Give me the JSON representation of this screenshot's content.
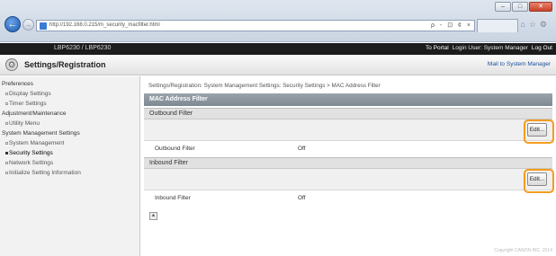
{
  "browser": {
    "url": "http://192.168.0.215/m_security_macfilter.html",
    "tools": "ρ - ⊡ ¢ ×"
  },
  "header": {
    "model": "LBP6230 / LBP6230",
    "to_portal": "To Portal",
    "login_user": "Login User: System Manager",
    "logout": "Log Out"
  },
  "subheader": {
    "title": "Settings/Registration",
    "mail": "Mail to System Manager"
  },
  "sidebar": {
    "groups": [
      {
        "label": "Preferences",
        "items": [
          {
            "label": "Display Settings"
          },
          {
            "label": "Timer Settings"
          }
        ]
      },
      {
        "label": "Adjustment/Maintenance",
        "items": [
          {
            "label": "Utility Menu"
          }
        ]
      },
      {
        "label": "System Management Settings",
        "items": [
          {
            "label": "System Management"
          },
          {
            "label": "Security Settings"
          },
          {
            "label": "Network Settings"
          },
          {
            "label": "Initialize Setting Information"
          }
        ]
      }
    ]
  },
  "main": {
    "breadcrumb": "Settings/Registration: System Management Settings: Security Settings > MAC Address Filter",
    "page_title": "MAC Address Filter",
    "outbound": {
      "heading": "Outbound Filter",
      "edit_label": "Edit...",
      "field_label": "Outbound Filter",
      "field_value": "Off"
    },
    "inbound": {
      "heading": "Inbound Filter",
      "edit_label": "Edit...",
      "field_label": "Inbound Filter",
      "field_value": "Off"
    }
  },
  "footer": {
    "copyright": "Copyright CANON INC. 2014"
  }
}
